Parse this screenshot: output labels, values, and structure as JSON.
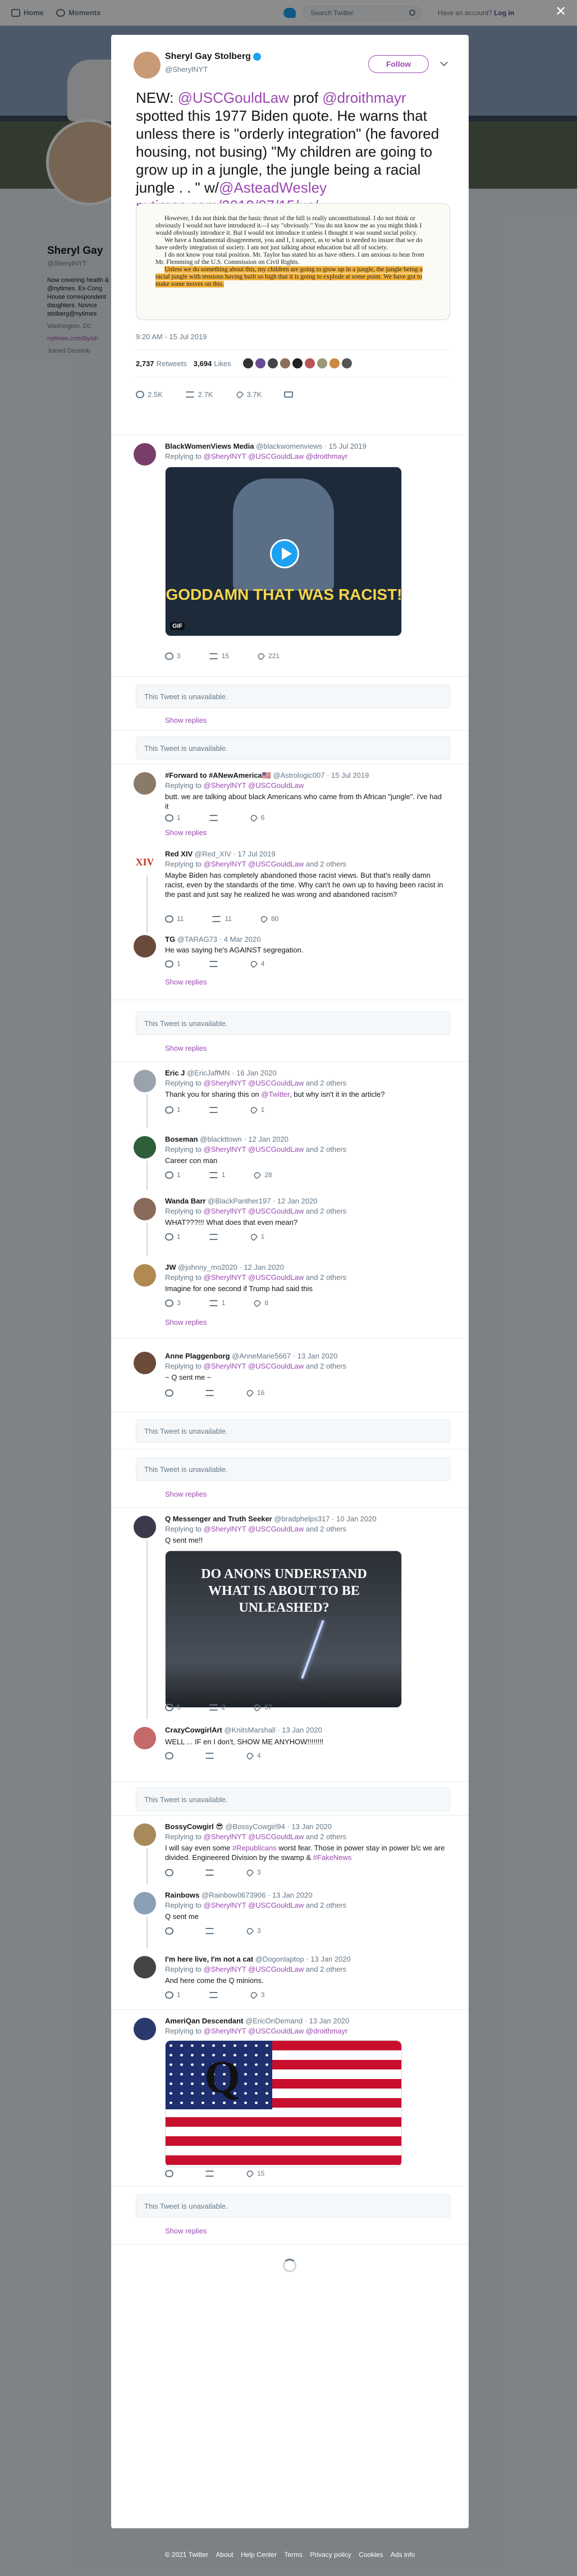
{
  "topnav": {
    "home": "Home",
    "moments": "Moments",
    "search_placeholder": "Search Twitter",
    "have_account": "Have an account?",
    "login": "Log in"
  },
  "profile": {
    "name": "Sheryl Gay",
    "handle": "@SherylNYT",
    "bio": "Now covering health & @nytimes. Ex-Cong House correspondent daughters. Novice stolberg@nytimes",
    "location": "Washington, DC",
    "website": "nytimes.com/by/sh",
    "joined": "Joined Decemb"
  },
  "main_tweet": {
    "name": "Sheryl Gay Stolberg",
    "handle": "@SherylNYT",
    "follow_label": "Follow",
    "text_1": "NEW: ",
    "mention_1": "@USCGouldLaw",
    "text_2": " prof ",
    "mention_2": "@droithmayr",
    "text_3": " spotted this 1977 Biden quote. He warns that unless there is \"orderly integration\" (he favored housing, not busing) \"My children are going to grow up in a jungle, the jungle being a racial jungle . . \" w/",
    "mention_3": "@AsteadWesley",
    "link": "nytimes.com/2019/07/15/us/ …",
    "doc_p1": "However, I do not think that the basic thrust of the bill is really unconstitutional. I do not think or obviously I would not have introduced it—I say \"obviously.\" You do not know me as you might think I would obviously introduce it. But I would not introduce it unless I thought it was sound social policy.",
    "doc_p2": "We have a fundamental disagreement, you and I, I suspect, as to what is needed to insure that we do have orderly integration of society. I am not just talking about education but all of society.",
    "doc_p3": "I do not know your total position. Mr. Taylor has stated his as have others. I am anxious to hear from Mr. Flemming of the U.S. Commission on Civil Rights.",
    "doc_p4": "Unless we do something about this, my children are going to grow up in a jungle, the jungle being a racial jungle with tensions having built so high that it is going to explode at some point. We have got to make some moves on this.",
    "time": "9:20 AM - 15 Jul 2019",
    "retweets_count": "2,737",
    "retweets_label": "Retweets",
    "likes_count": "3,694",
    "likes_label": "Likes",
    "reply_count": "2.5K",
    "rt_count": "2.7K",
    "like_count": "3.7K"
  },
  "replies": [
    {
      "name": "BlackWomenViews Media",
      "handle": "@blackwomenviews",
      "date": "15 Jul 2019",
      "to": "Replying to",
      "to_links": "@SherylNYT @USCGouldLaw @droithmayr",
      "text": "",
      "media_caption": "GODDAMN THAT WAS RACIST!",
      "gif": "GIF",
      "r": "3",
      "rt": "15",
      "l": "221"
    },
    {
      "unavailable": "This Tweet is unavailable.",
      "show_replies": "Show replies"
    },
    {
      "unavailable": "This Tweet is unavailable."
    },
    {
      "name": "#Forward to #ANewAmerica🇺🇸",
      "handle": "@Astrologic007",
      "date": "15 Jul 2019",
      "to": "Replying to",
      "to_links": "@SherylNYT @USCGouldLaw",
      "text": "butt. we are talking about black Americans who came from th African \"jungle\". i've had it",
      "r": "1",
      "rt": "",
      "l": "6",
      "show_replies": "Show replies"
    },
    {
      "name": "Red XIV",
      "handle": "@Red_XIV",
      "date": "17 Jul 2019",
      "to": "Replying to",
      "to_links": "@SherylNYT @USCGouldLaw",
      "to_more": "and 2 others",
      "text": "Maybe Biden has completely abandoned those racist views. But that's really damn racist, even by the standards of the time. Why can't he own up to having been racist in the past and just say he realized he was wrong and abandoned racism?",
      "avatar_text": "XIV",
      "r": "11",
      "rt": "11",
      "l": "80"
    },
    {
      "name": "TG",
      "handle": "@TARAG73",
      "date": "4 Mar 2020",
      "to": "",
      "to_links": "",
      "text": "He was saying he's AGAINST segregation.",
      "r": "1",
      "rt": "",
      "l": "4",
      "show_replies": "Show replies"
    },
    {
      "unavailable": "This Tweet is unavailable.",
      "show_replies": "Show replies"
    },
    {
      "name": "Eric J",
      "handle": "@EricJaffMN",
      "date": "16 Jan 2020",
      "to": "Replying to",
      "to_links": "@SherylNYT @USCGouldLaw",
      "to_more": "and 2 others",
      "text_pre": "Thank you for sharing this on ",
      "text_link": "@Twitter",
      "text_post": ", but why isn't it in the article?",
      "r": "1",
      "rt": "",
      "l": "1"
    },
    {
      "name": "Boseman",
      "handle": "@blackttown",
      "date": "12 Jan 2020",
      "to": "Replying to",
      "to_links": "@SherylNYT @USCGouldLaw",
      "to_more": "and 2 others",
      "text": "Career con man",
      "r": "1",
      "rt": "1",
      "l": "28"
    },
    {
      "name": "Wanda Barr",
      "handle": "@BlackPanther197",
      "date": "12 Jan 2020",
      "to": "Replying to",
      "to_links": "@SherylNYT @USCGouldLaw",
      "to_more": "and 2 others",
      "text": "WHAT???!!! What does that even mean?",
      "r": "1",
      "rt": "",
      "l": "1"
    },
    {
      "name": "JW",
      "handle": "@johnny_mo2020",
      "date": "12 Jan 2020",
      "to": "Replying to",
      "to_links": "@SherylNYT @USCGouldLaw",
      "to_more": "and 2 others",
      "text": "Imagine for one second if Trump had said this",
      "r": "3",
      "rt": "1",
      "l": "8",
      "show_replies": "Show replies"
    },
    {
      "name": "Anne Plaggenborg",
      "handle": "@AnneMarie5667",
      "date": "13 Jan 2020",
      "to": "Replying to",
      "to_links": "@SherylNYT @USCGouldLaw",
      "to_more": "and 2 others",
      "text": "~ Q sent me ~",
      "r": "",
      "rt": "",
      "l": "16"
    },
    {
      "unavailable": "This Tweet is unavailable."
    },
    {
      "unavailable": "This Tweet is unavailable.",
      "show_replies": "Show replies"
    },
    {
      "name": "Q Messenger and Truth Seeker",
      "handle": "@bradphelps317",
      "date": "10 Jan 2020",
      "to": "Replying to",
      "to_links": "@SherylNYT @USCGouldLaw",
      "to_more": "and 2 others",
      "text": "Q sent me!!",
      "media_caption": "DO ANONS UNDERSTAND WHAT IS ABOUT TO BE UNLEASHED?",
      "r": "5",
      "rt": "2",
      "l": "57"
    },
    {
      "name": "CrazyCowgirlArt",
      "handle": "@KnitsMarshall",
      "date": "13 Jan 2020",
      "to": "",
      "to_links": "",
      "text": "WELL ... IF en I don't, SHOW ME ANYHOW!!!!!!!!",
      "r": "",
      "rt": "",
      "l": "4"
    },
    {
      "unavailable": "This Tweet is unavailable."
    },
    {
      "name": "BossyCowgirl 😎",
      "handle": "@BossyCowgirl94",
      "date": "13 Jan 2020",
      "to": "Replying to",
      "to_links": "@SherylNYT @USCGouldLaw",
      "to_more": "and 2 others",
      "text_pre": "I will say even some ",
      "text_link": "#Republicans",
      "text_mid": " worst fear. Those in power stay in power b/c we are divided. Engineered Division by the swamp & ",
      "text_link2": "#FakeNews",
      "r": "",
      "rt": "",
      "l": "3"
    },
    {
      "name": "Rainbows",
      "handle": "@Rainbow0673906",
      "date": "13 Jan 2020",
      "to": "Replying to",
      "to_links": "@SherylNYT @USCGouldLaw",
      "to_more": "and 2 others",
      "text": "Q sent me",
      "r": "",
      "rt": "",
      "l": "3"
    },
    {
      "name": "I'm here live, I'm not a cat",
      "handle": "@Dogonlaptop",
      "date": "13 Jan 2020",
      "to": "Replying to",
      "to_links": "@SherylNYT @USCGouldLaw",
      "to_more": "and 2 others",
      "text": "And here come the Q minions.",
      "r": "1",
      "rt": "",
      "l": "3"
    },
    {
      "name": "AmeriQan Descendant",
      "handle": "@EricOnDemand",
      "date": "13 Jan 2020",
      "to": "Replying to",
      "to_links": "@SherylNYT @USCGouldLaw @droithmayr",
      "text": "",
      "media_letter": "Q",
      "r": "",
      "rt": "",
      "l": "15"
    },
    {
      "unavailable": "This Tweet is unavailable.",
      "show_replies": "Show replies"
    }
  ],
  "footer": {
    "copyright": "© 2021 Twitter",
    "about": "About",
    "help": "Help Center",
    "terms": "Terms",
    "privacy": "Privacy policy",
    "cookies": "Cookies",
    "ads": "Ads info"
  },
  "colors": {
    "link": "#9a4ab0",
    "highlight": "#f3b13a",
    "verified": "#1da1f2"
  }
}
